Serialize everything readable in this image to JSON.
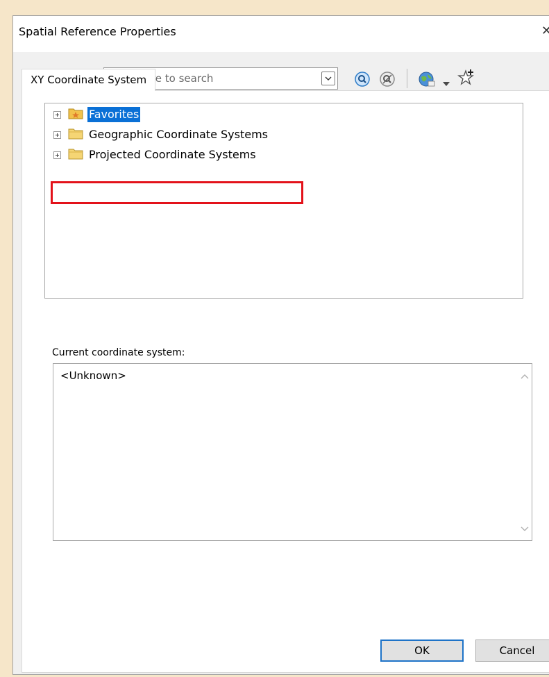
{
  "window": {
    "title": "Spatial Reference Properties",
    "close_glyph": "✕"
  },
  "tabs": [
    {
      "label": "XY Coordinate System",
      "active": true
    }
  ],
  "toolbar": {
    "search_placeholder": "Type here to search",
    "icons": [
      "filter-icon",
      "dropdown-arrow-icon",
      "search-icon",
      "clear-search-icon",
      "globe-icon",
      "add-favorite-icon"
    ]
  },
  "tree": {
    "items": [
      {
        "label": "Favorites",
        "icon": "favorites-folder-icon",
        "selected": true
      },
      {
        "label": "Geographic Coordinate Systems",
        "icon": "folder-icon",
        "selected": false
      },
      {
        "label": "Projected Coordinate Systems",
        "icon": "folder-icon",
        "selected": false,
        "highlighted": true
      }
    ]
  },
  "current": {
    "label": "Current coordinate system:",
    "value": "<Unknown>"
  },
  "buttons": {
    "ok": "OK",
    "cancel": "Cancel"
  },
  "colors": {
    "background": "#f6e6c9",
    "selection": "#0a70d6",
    "highlight_box": "#e3121a",
    "default_button_border": "#1e73c8"
  }
}
